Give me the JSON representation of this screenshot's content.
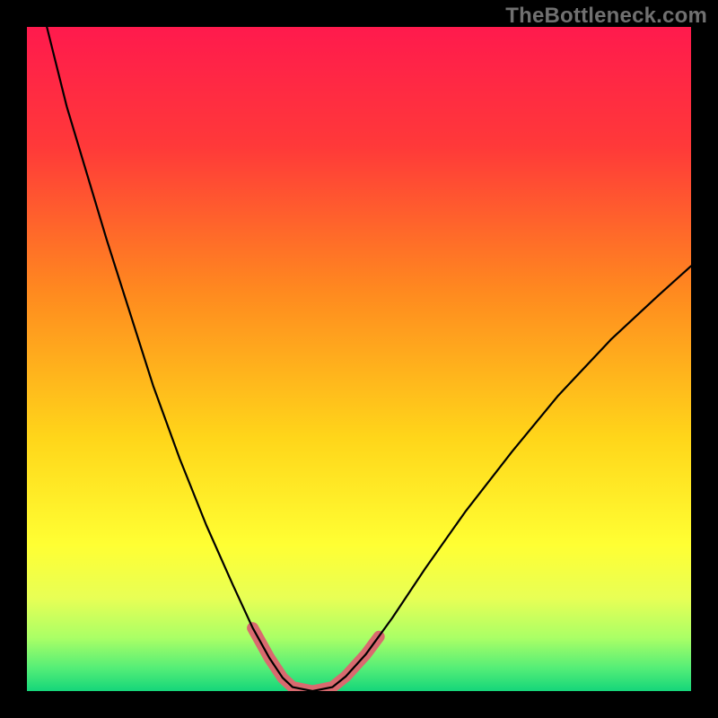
{
  "watermark": {
    "text": "TheBottleneck.com"
  },
  "chart_data": {
    "type": "line",
    "title": "",
    "xlabel": "",
    "ylabel": "",
    "xlim": [
      0,
      100
    ],
    "ylim": [
      0,
      100
    ],
    "grid": false,
    "legend": false,
    "annotations": [],
    "gradient_stops": [
      {
        "offset": 0.0,
        "color": "#ff1a4d"
      },
      {
        "offset": 0.18,
        "color": "#ff3939"
      },
      {
        "offset": 0.4,
        "color": "#ff8a1f"
      },
      {
        "offset": 0.62,
        "color": "#ffd61a"
      },
      {
        "offset": 0.78,
        "color": "#ffff33"
      },
      {
        "offset": 0.86,
        "color": "#e8ff55"
      },
      {
        "offset": 0.92,
        "color": "#aaff66"
      },
      {
        "offset": 0.965,
        "color": "#55ee77"
      },
      {
        "offset": 1.0,
        "color": "#15d67a"
      }
    ],
    "series": [
      {
        "name": "bottleneck-curve",
        "stroke": "#000000",
        "stroke_width": 2.2,
        "points": [
          {
            "x": 3.0,
            "y": 100.0
          },
          {
            "x": 4.0,
            "y": 96.0
          },
          {
            "x": 6.0,
            "y": 88.0
          },
          {
            "x": 9.0,
            "y": 78.0
          },
          {
            "x": 12.0,
            "y": 68.0
          },
          {
            "x": 15.5,
            "y": 57.0
          },
          {
            "x": 19.0,
            "y": 46.0
          },
          {
            "x": 23.0,
            "y": 35.0
          },
          {
            "x": 27.0,
            "y": 25.0
          },
          {
            "x": 31.0,
            "y": 16.0
          },
          {
            "x": 34.0,
            "y": 9.5
          },
          {
            "x": 36.5,
            "y": 5.0
          },
          {
            "x": 38.5,
            "y": 2.0
          },
          {
            "x": 40.0,
            "y": 0.6
          },
          {
            "x": 43.0,
            "y": 0.0
          },
          {
            "x": 46.0,
            "y": 0.6
          },
          {
            "x": 48.0,
            "y": 2.2
          },
          {
            "x": 51.0,
            "y": 5.5
          },
          {
            "x": 55.0,
            "y": 11.0
          },
          {
            "x": 60.0,
            "y": 18.5
          },
          {
            "x": 66.0,
            "y": 27.0
          },
          {
            "x": 73.0,
            "y": 36.0
          },
          {
            "x": 80.0,
            "y": 44.5
          },
          {
            "x": 88.0,
            "y": 53.0
          },
          {
            "x": 95.0,
            "y": 59.5
          },
          {
            "x": 100.0,
            "y": 64.0
          }
        ]
      },
      {
        "name": "optimal-band",
        "type": "band",
        "stroke": "#d96a6f",
        "stroke_width": 13,
        "linecap": "round",
        "points": [
          {
            "x": 34.0,
            "y": 9.5
          },
          {
            "x": 36.5,
            "y": 5.0
          },
          {
            "x": 38.5,
            "y": 2.0
          },
          {
            "x": 40.0,
            "y": 0.6
          },
          {
            "x": 43.0,
            "y": 0.0
          },
          {
            "x": 46.0,
            "y": 0.6
          },
          {
            "x": 48.0,
            "y": 2.2
          },
          {
            "x": 51.0,
            "y": 5.5
          },
          {
            "x": 53.0,
            "y": 8.2
          }
        ]
      }
    ]
  }
}
